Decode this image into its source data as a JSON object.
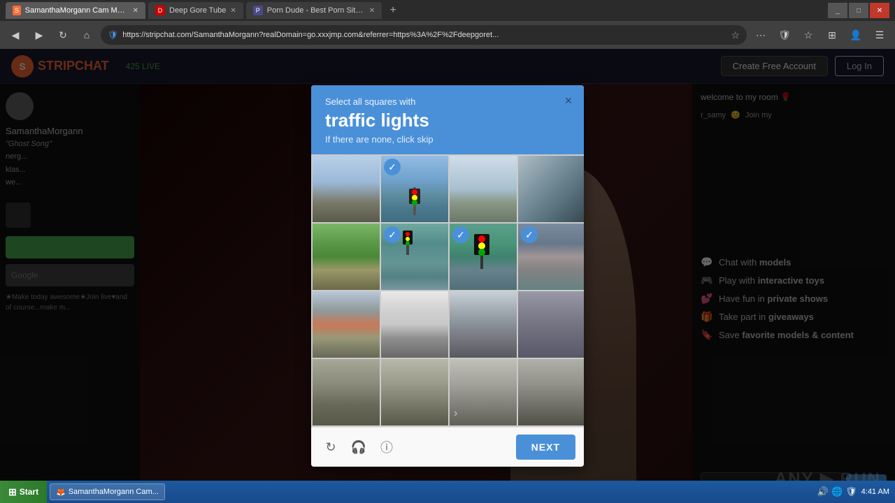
{
  "browser": {
    "tabs": [
      {
        "label": "SamanthaMorgann Cam Model: Fr...",
        "active": true,
        "favicon": "S"
      },
      {
        "label": "Deep Gore Tube",
        "active": false,
        "favicon": "D"
      },
      {
        "label": "Porn Dude - Best Porn Sites & Fre...",
        "active": false,
        "favicon": "P"
      }
    ],
    "address": "https://stripchat.com/SamanthaMorgann?realDomain=go.xxxjmp.com&referrer=https%3A%2F%2Fdeepgoret...",
    "window_controls": [
      "_",
      "□",
      "✕"
    ]
  },
  "page": {
    "header": {
      "logo": "S",
      "brand_strip": "STRIP",
      "brand_chat": "CHAT",
      "live_count": "425 LIVE",
      "buttons": {
        "create_account": "Create Free Account",
        "login": "Log In"
      }
    },
    "sidebar": {
      "username": "SamanthaMorgann",
      "messages": [
        {
          "text": "\"Ghost Song\""
        },
        {
          "text": "nerg..."
        },
        {
          "text": "klas..."
        },
        {
          "text": "we..."
        }
      ]
    },
    "features": [
      {
        "icon": "💬",
        "text_plain": "Chat with ",
        "text_bold": "models"
      },
      {
        "icon": "🎮",
        "text_plain": "Play with ",
        "text_bold": "interactive toys"
      },
      {
        "icon": "💕",
        "text_plain": "Have fun in ",
        "text_bold": "private shows"
      },
      {
        "icon": "🎁",
        "text_plain": "Take part in ",
        "text_bold": "giveaways"
      },
      {
        "icon": "🔖",
        "text_plain": "Save ",
        "text_bold": "favorite models & content"
      }
    ]
  },
  "captcha": {
    "header": {
      "select_text": "Select all squares with",
      "main_text": "traffic lights",
      "sub_text": "If there are none, click skip"
    },
    "close_label": "×",
    "grid": [
      {
        "row": 0,
        "col": 0,
        "selected": false,
        "img_class": "img-sky-intersection"
      },
      {
        "row": 0,
        "col": 1,
        "selected": true,
        "img_class": "img-traffic-light-pole"
      },
      {
        "row": 0,
        "col": 2,
        "selected": false,
        "img_class": "img-sky-wide"
      },
      {
        "row": 0,
        "col": 3,
        "selected": false,
        "img_class": "img-overpass"
      },
      {
        "row": 1,
        "col": 0,
        "selected": false,
        "img_class": "img-street-green"
      },
      {
        "row": 1,
        "col": 1,
        "selected": true,
        "img_class": "img-traffic-pole2"
      },
      {
        "row": 1,
        "col": 2,
        "selected": true,
        "img_class": "img-traffic-close"
      },
      {
        "row": 1,
        "col": 3,
        "selected": true,
        "img_class": "img-intersection-buildings"
      },
      {
        "row": 2,
        "col": 0,
        "selected": false,
        "img_class": "img-cars-street"
      },
      {
        "row": 2,
        "col": 1,
        "selected": false,
        "img_class": "img-car-white"
      },
      {
        "row": 2,
        "col": 2,
        "selected": false,
        "img_class": "img-car-truck"
      },
      {
        "row": 2,
        "col": 3,
        "selected": false,
        "img_class": "img-empty-street"
      },
      {
        "row": 3,
        "col": 0,
        "selected": false,
        "img_class": "img-road-empty"
      },
      {
        "row": 3,
        "col": 1,
        "selected": false,
        "img_class": "img-parking-lot"
      },
      {
        "row": 3,
        "col": 2,
        "selected": false,
        "img_class": "img-gray-road"
      },
      {
        "row": 3,
        "col": 3,
        "selected": false,
        "img_class": "img-road-lane"
      }
    ],
    "footer": {
      "refresh_icon": "↻",
      "audio_icon": "🎧",
      "info_icon": "ⓘ",
      "next_btn": "NEXT"
    }
  },
  "taskbar": {
    "start_label": "Start",
    "items": [
      {
        "label": "SamanthaMorgann Cam..."
      }
    ],
    "clock": "4:41 AM",
    "tray_icons": [
      "🔊",
      "🌐",
      "🛡"
    ]
  }
}
